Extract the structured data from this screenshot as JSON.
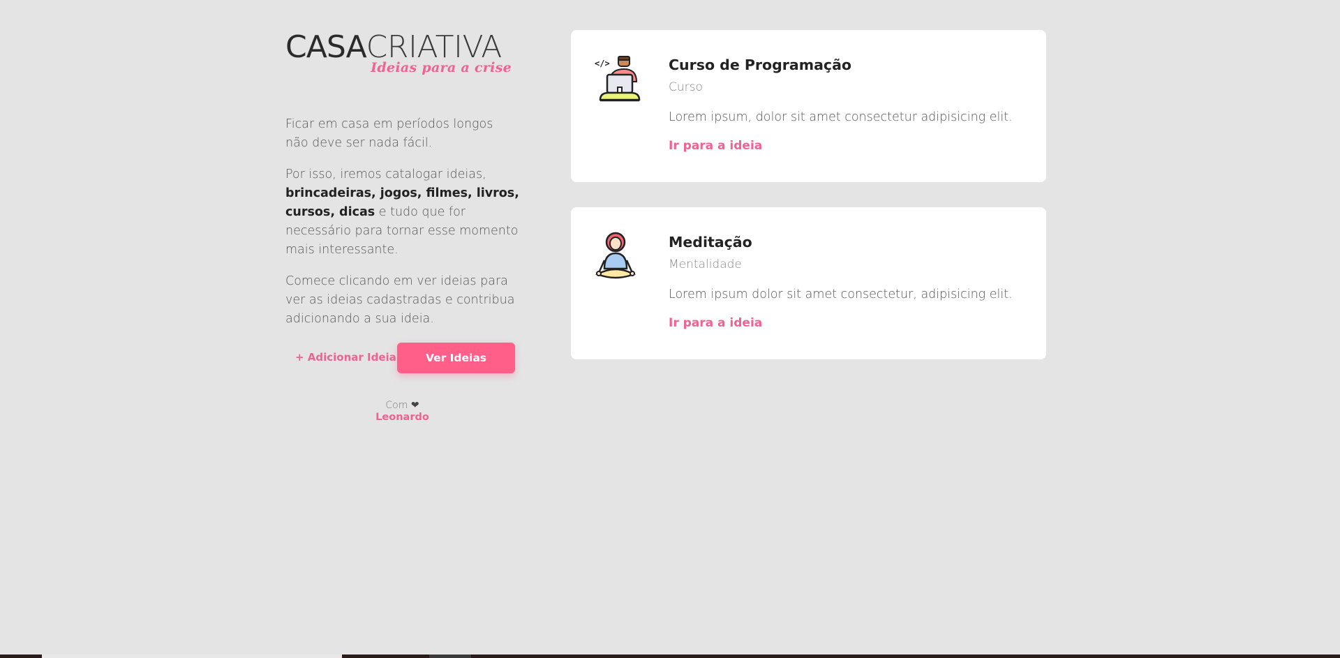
{
  "logo": {
    "main_bold": "CASA",
    "main_light": "CRIATIVA",
    "tagline": "Ideias para a crise"
  },
  "intro": {
    "p1": "Ficar em casa em períodos longos não deve ser nada fácil.",
    "p2_start": "Por isso, iremos catalogar ideias, ",
    "p2_bold": "brincadeiras, jogos, filmes, livros, cursos, dicas",
    "p2_end": " e tudo que for necessário para tornar esse momento mais interessante.",
    "p3": "Comece clicando em ver ideias para ver as ideias cadastradas e contribua adicionando a sua ideia."
  },
  "actions": {
    "add_label": "+ Adicionar Ideia",
    "view_label": "Ver Ideias"
  },
  "credit": {
    "prefix": "Com",
    "heart": "❤",
    "name": "Leonardo"
  },
  "cards": [
    {
      "icon": "programmer-icon",
      "title": "Curso de Programação",
      "category": "Curso",
      "description": "Lorem ipsum, dolor sit amet consectetur adipisicing elit.",
      "link_label": "Ir para a ideia"
    },
    {
      "icon": "meditation-icon",
      "title": "Meditação",
      "category": "Mentalidade",
      "description": "Lorem ipsum dolor sit amet consectetur, adipisicing elit.",
      "link_label": "Ir para a ideia"
    }
  ],
  "colors": {
    "background": "#e4e4e4",
    "accent": "#ff5f89",
    "link": "#f06292"
  }
}
